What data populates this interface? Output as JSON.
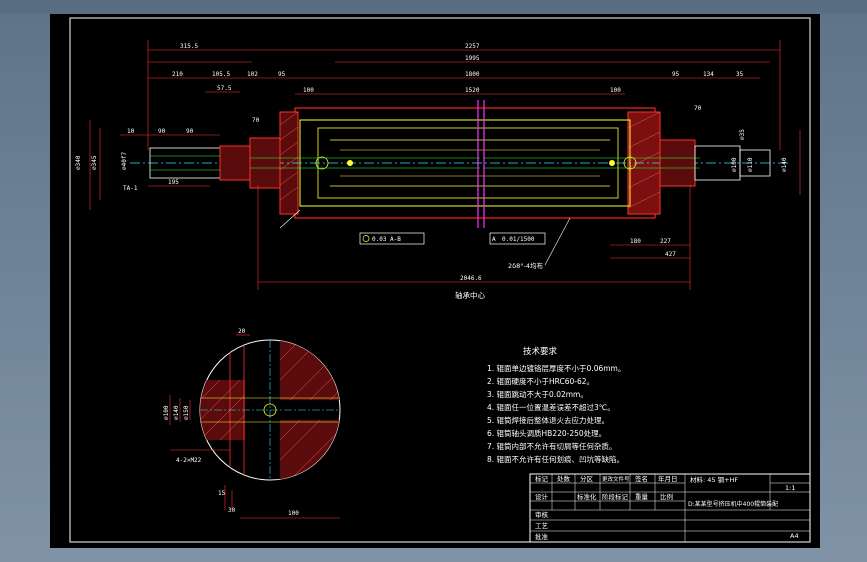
{
  "drawing": {
    "overall_dims": [
      "2257",
      "1995",
      "1800",
      "1520"
    ],
    "top_left_dims": [
      "315.5",
      "210",
      "105.5",
      "102",
      "95",
      "100",
      "57.5",
      "70"
    ],
    "top_right_dims": [
      "95",
      "134",
      "35",
      "70",
      "100"
    ],
    "left_detail_dims": [
      "10",
      "90",
      "90",
      "195",
      "TA-1"
    ],
    "left_diameters": [
      "⌀340",
      "⌀345",
      "⌀40f7"
    ],
    "right_diameters": [
      "⌀100",
      "⌀110",
      "⌀140",
      "⌀35"
    ],
    "bottom_dims": [
      "180",
      "227",
      "427",
      "2046.6"
    ],
    "tolerance_1": "0.03  A-B",
    "tolerance_2": "0.01/1500",
    "tolerance_ref": "A",
    "weld_note": "2δ8°-4均布",
    "centerline_label": "轴承中心",
    "section_dims": [
      "20",
      "⌀100",
      "⌀140",
      "⌀150",
      "15",
      "30",
      "100",
      "4-2×M22"
    ]
  },
  "tech_requirements": {
    "title": "技术要求",
    "items": [
      "1. 辊面单边镀铬层厚度不小于0.06mm。",
      "2. 辊面硬度不小于HRC60-62。",
      "3. 辊面跳动不大于0.02mm。",
      "4. 辊面任一位置温差误差不超过3℃。",
      "5. 辊筒焊接后整体退火去应力处理。",
      "6. 辊筒轴头调质HB220-250处理。",
      "7. 辊筒内部不允许有切屑等任何杂质。",
      "8. 辊面不允许有任何划痕、凹坑等缺陷。"
    ]
  },
  "title_block": {
    "material": "材料: 45 钢+HF",
    "drawing_title": "D:某某型号挤压机中400辊筒装配",
    "scale": "1:1",
    "sheet": "A4",
    "header_cells": [
      "标记",
      "处数",
      "分区",
      "更改文件号",
      "签名",
      "年月日"
    ],
    "row_cells": [
      "设计",
      "标准化",
      "阶段标记",
      "重量",
      "比例"
    ],
    "row_cells_2": [
      "审核",
      "工艺",
      "批准"
    ]
  }
}
